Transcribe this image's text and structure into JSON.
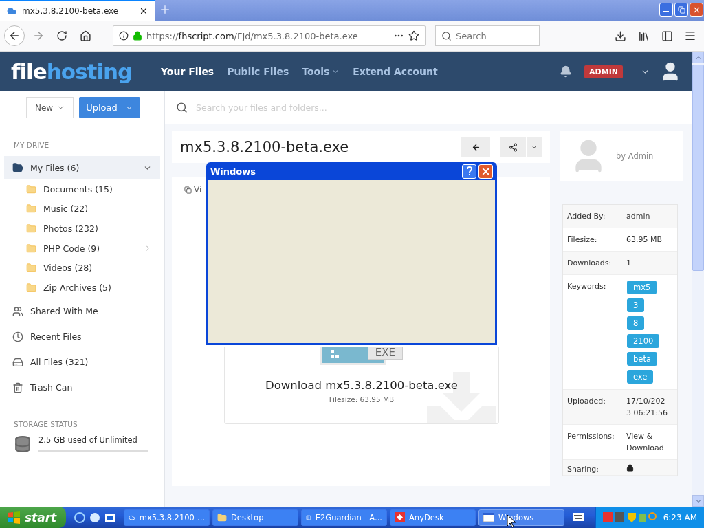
{
  "browser": {
    "tab_title": "mx5.3.8.2100-beta.exe",
    "url_scheme": "https://",
    "url_host": "fhscript.com",
    "url_path": "/FJd/mx5.3.8.2100-beta.exe",
    "search_placeholder": "Search"
  },
  "site": {
    "logo_first": "file",
    "logo_second": "hosting",
    "badge": "ADMIN",
    "nav": [
      {
        "label": "Your Files",
        "selected": true,
        "dropdown": false
      },
      {
        "label": "Public Files",
        "selected": false,
        "dropdown": false
      },
      {
        "label": "Tools",
        "selected": false,
        "dropdown": true
      },
      {
        "label": "Extend Account",
        "selected": false,
        "dropdown": false
      }
    ]
  },
  "toolbar": {
    "new_button": "New",
    "upload_button": "Upload",
    "search_placeholder": "Search your files and folders..."
  },
  "sidebar": {
    "section_title": "MY DRIVE",
    "storage_title": "STORAGE STATUS",
    "storage_text": "2.5 GB used of Unlimited",
    "items": [
      {
        "label": "My Files (6)",
        "kind": "drive",
        "selected": true,
        "expanded": true,
        "children": [
          {
            "label": "Documents (15)",
            "has_children": false
          },
          {
            "label": "Music (22)",
            "has_children": false
          },
          {
            "label": "Photos (232)",
            "has_children": false
          },
          {
            "label": "PHP Code (9)",
            "has_children": true
          },
          {
            "label": "Videos (28)",
            "has_children": false
          },
          {
            "label": "Zip Archives (5)",
            "has_children": false
          }
        ]
      },
      {
        "label": "Shared With Me",
        "kind": "shared",
        "selected": false
      },
      {
        "label": "Recent Files",
        "kind": "recent",
        "selected": false
      },
      {
        "label": "All Files (321)",
        "kind": "all",
        "selected": false
      },
      {
        "label": "Trash Can",
        "kind": "trash",
        "selected": false
      }
    ]
  },
  "file": {
    "title": "mx5.3.8.2100-beta.exe",
    "tab_label": "Vi",
    "download_label": "Download mx5.3.8.2100-beta.exe",
    "filesize": "Filesize: 63.95 MB",
    "icon_label": "EXE"
  },
  "uploader": {
    "by": "by Admin"
  },
  "details": [
    {
      "label": "Added By:",
      "kind": "text",
      "value": "admin"
    },
    {
      "label": "Filesize:",
      "kind": "text",
      "value": "63.95 MB"
    },
    {
      "label": "Downloads:",
      "kind": "text",
      "value": "1"
    },
    {
      "label": "Keywords:",
      "kind": "tags",
      "tags": [
        "mx5",
        "3",
        "8",
        "2100",
        "beta",
        "exe"
      ]
    },
    {
      "label": "Uploaded:",
      "kind": "text",
      "value": "17/10/2023 06:21:56"
    },
    {
      "label": "Permissions:",
      "kind": "text",
      "value": "View & Download"
    },
    {
      "label": "Sharing:",
      "kind": "lock"
    }
  ],
  "dialog": {
    "title": "Windows"
  },
  "taskbar": {
    "start": "start",
    "clock": "6:23 AM",
    "tasks": [
      {
        "label": "mx5.3.8.2100-...",
        "kind": "browser",
        "selected": false
      },
      {
        "label": "Desktop",
        "kind": "folder",
        "selected": false
      },
      {
        "label": "E2Guardian - A...",
        "kind": "app",
        "selected": false
      },
      {
        "label": "AnyDesk",
        "kind": "anydesk",
        "selected": false
      },
      {
        "label": "Windows",
        "kind": "window",
        "selected": true
      }
    ]
  }
}
